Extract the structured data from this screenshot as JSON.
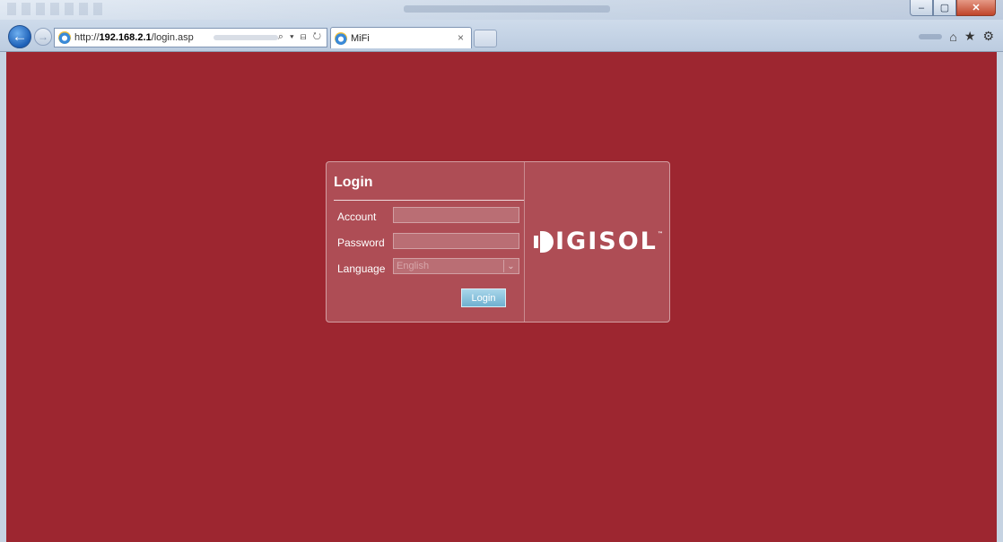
{
  "browser": {
    "url_prefix": "http://",
    "url_host": "192.168.2.1",
    "url_path": "/login.asp",
    "address_tools": "⌕ ▾ ⊟ ↻",
    "tab_title": "MiFi",
    "tab_close": "×",
    "back_glyph": "←",
    "forward_glyph": "→",
    "window": {
      "minimize": "–",
      "maximize": "▢",
      "close": "✕"
    },
    "toolbar_icons": [
      "home-icon",
      "favorites-icon",
      "settings-icon"
    ]
  },
  "login": {
    "title": "Login",
    "account_label": "Account",
    "account_value": "",
    "password_label": "Password",
    "password_value": "",
    "language_label": "Language",
    "language_selected": "English",
    "submit_label": "Login"
  },
  "brand": {
    "name": "IGISOL",
    "tm": "™"
  },
  "colors": {
    "page_background": "#9d2630",
    "input_background": "#ba6e74",
    "button": "#6fb0d0"
  }
}
